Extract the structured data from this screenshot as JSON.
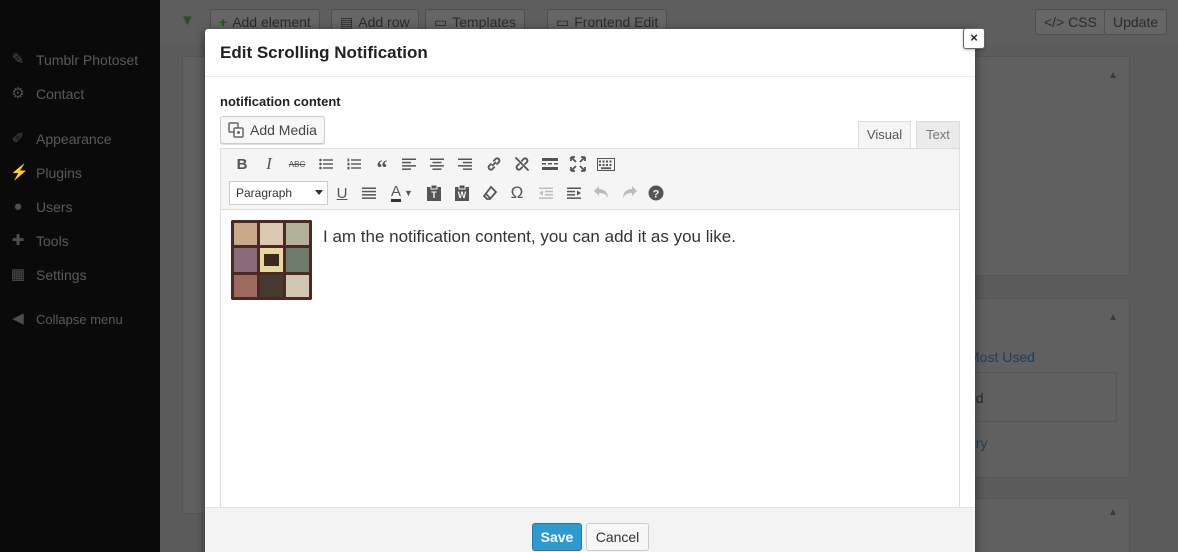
{
  "sidebar": {
    "items": [
      {
        "label": "Tumblr Photoset",
        "icon": "pin-icon"
      },
      {
        "label": "Contact",
        "icon": "gear-icon"
      },
      {
        "label": "Appearance",
        "icon": "brush-icon"
      },
      {
        "label": "Plugins",
        "icon": "plug-icon"
      },
      {
        "label": "Users",
        "icon": "user-icon"
      },
      {
        "label": "Tools",
        "icon": "wrench-icon"
      },
      {
        "label": "Settings",
        "icon": "settings-icon"
      }
    ],
    "collapse_label": "Collapse menu"
  },
  "toolbar": {
    "add_element": "Add element",
    "add_row": "Add row",
    "templates": "Templates",
    "frontend_edit": "Frontend Edit",
    "css": "</> CSS",
    "update": "Update"
  },
  "background": {
    "most_used": "Most Used",
    "ed": "ed",
    "ory": "ory"
  },
  "modal": {
    "title": "Edit Scrolling Notification",
    "close_label": "×",
    "field_label": "notification content",
    "add_media_label": "Add Media",
    "tabs": {
      "visual": "Visual",
      "text": "Text"
    },
    "format_select": {
      "selected": "Paragraph"
    },
    "content_text": "I am the notification content, you can add it as you like.",
    "save_label": "Save",
    "cancel_label": "Cancel"
  },
  "colors": {
    "primary_button": "#2e9ad0",
    "sidebar": "#0a0a0a",
    "modal_bg": "#ffffff"
  }
}
